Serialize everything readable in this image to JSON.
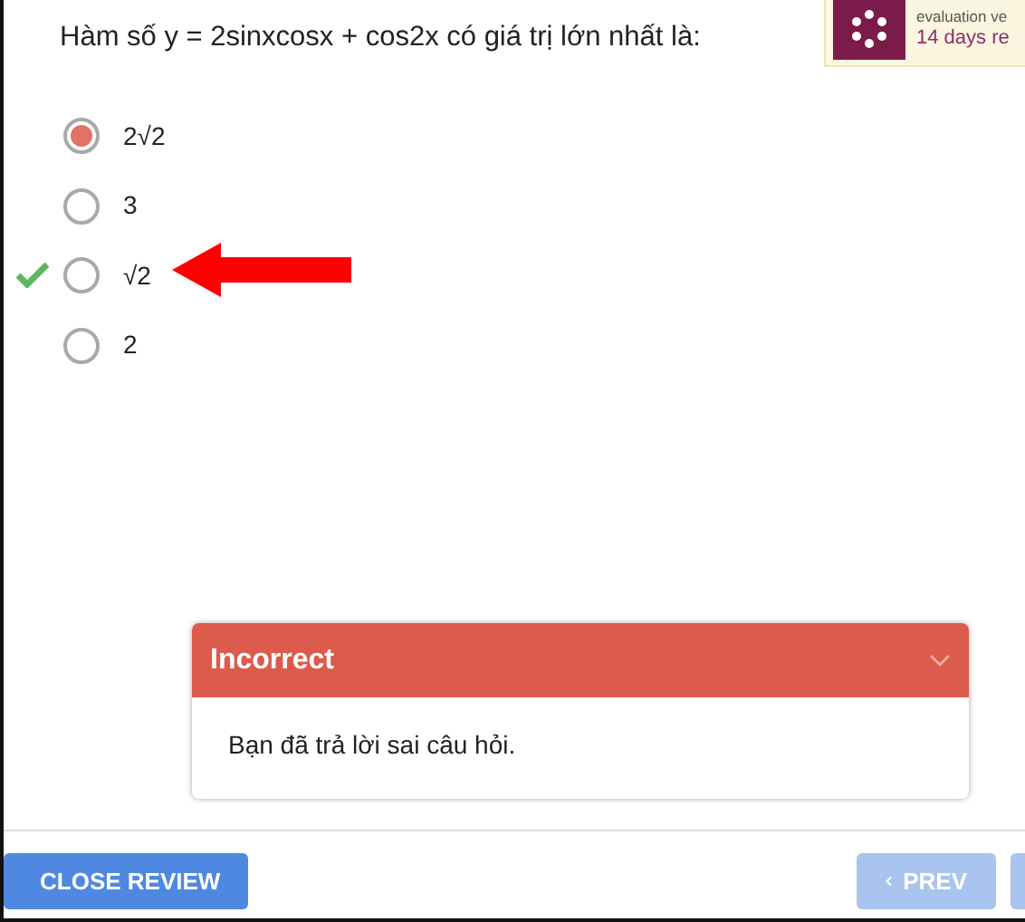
{
  "notice": {
    "lines": [
      "evaluation ve"
    ],
    "trial": "14 days re"
  },
  "question": "Hàm số y = 2sinxcosx + cos2x có giá trị lớn nhất là:",
  "options": [
    {
      "label": "2√2",
      "selected": true,
      "correct": false
    },
    {
      "label": "3",
      "selected": false,
      "correct": false
    },
    {
      "label": "√2",
      "selected": false,
      "correct": true
    },
    {
      "label": "2",
      "selected": false,
      "correct": false
    }
  ],
  "feedback": {
    "title": "Incorrect",
    "message": "Bạn đã trả lời sai câu hỏi."
  },
  "buttons": [
    {
      "label": "CLOSE REVIEW",
      "kind": "close",
      "disabled": false
    },
    {
      "label": "PREV",
      "kind": "prev",
      "disabled": true
    },
    {
      "kind": "next",
      "disabled": true
    }
  ]
}
